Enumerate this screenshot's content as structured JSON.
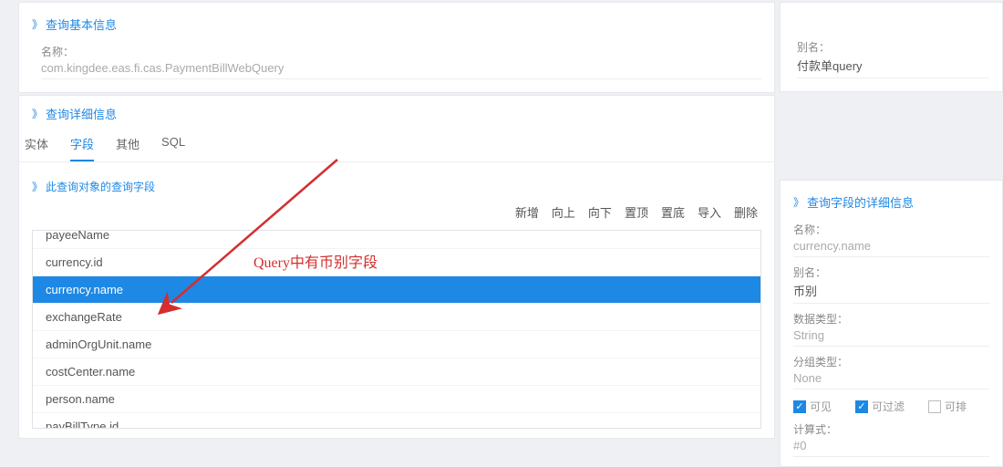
{
  "basic": {
    "header": "查询基本信息",
    "name_label": "名称：",
    "name_value": "com.kingdee.eas.fi.cas.PaymentBillWebQuery",
    "alias_label": "别名：",
    "alias_value": "付款单query"
  },
  "detail": {
    "header": "查询详细信息",
    "tabs": {
      "entity": "实体",
      "field": "字段",
      "other": "其他",
      "sql": "SQL"
    },
    "sub_header": "此查询对象的查询字段",
    "toolbar": {
      "add": "新增",
      "up": "向上",
      "down": "向下",
      "top": "置顶",
      "bottom": "置底",
      "import": "导入",
      "delete": "删除"
    },
    "fields": [
      "payeeName",
      "currency.id",
      "currency.name",
      "exchangeRate",
      "adminOrgUnit.name",
      "costCenter.name",
      "person.name",
      "payBillType.id"
    ],
    "selected_index": 2
  },
  "right": {
    "header": "查询字段的详细信息",
    "name_label": "名称：",
    "name_value": "currency.name",
    "alias_label": "别名：",
    "alias_value": "币别",
    "dtype_label": "数据类型：",
    "dtype_value": "String",
    "gtype_label": "分组类型：",
    "gtype_value": "None",
    "visible_label": "可见",
    "filter_label": "可过滤",
    "sort_label": "可排",
    "calc_label": "计算式：",
    "calc_value": "#0"
  },
  "annotation": {
    "text": "Query中有币别字段"
  }
}
